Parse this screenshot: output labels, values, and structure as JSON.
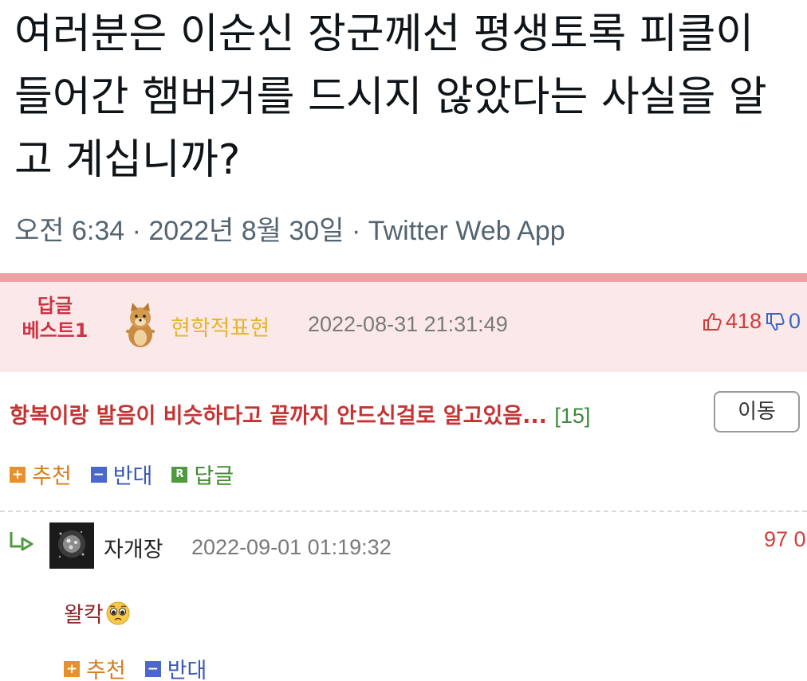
{
  "tweet": {
    "text": "여러분은 이순신 장군께선 평생토록 피클이 들어간 햄버거를 드시지 않았다는 사실을 알고 계십니까?",
    "meta": "오전 6:34 · 2022년 8월 30일 · Twitter Web App"
  },
  "best_comment": {
    "label_line1": "답글",
    "label_line2": "베스트1",
    "avatar_icon": "dog-avatar-icon",
    "nickname": "현학적표현",
    "datetime": "2022-08-31 21:31:49",
    "likes": "418",
    "dislikes": "0",
    "body": "항복이랑 발음이 비슷하다고 끝까지 안드신걸로 알고있음...",
    "reply_count": "[15]",
    "move_label": "이동",
    "actions": {
      "recommend": "추천",
      "oppose": "반대",
      "reply": "답글",
      "reply_badge": "R"
    }
  },
  "reply": {
    "nickname": "자개장",
    "datetime": "2022-09-01 01:19:32",
    "likes": "97 0",
    "body": "왈칵",
    "actions": {
      "recommend": "추천",
      "oppose": "반대"
    }
  },
  "colors": {
    "pink_bar": "#eca2a2",
    "best_bg": "#fbe9e9",
    "best_label": "#cc3344",
    "nickname_gold": "#e5b52e"
  }
}
